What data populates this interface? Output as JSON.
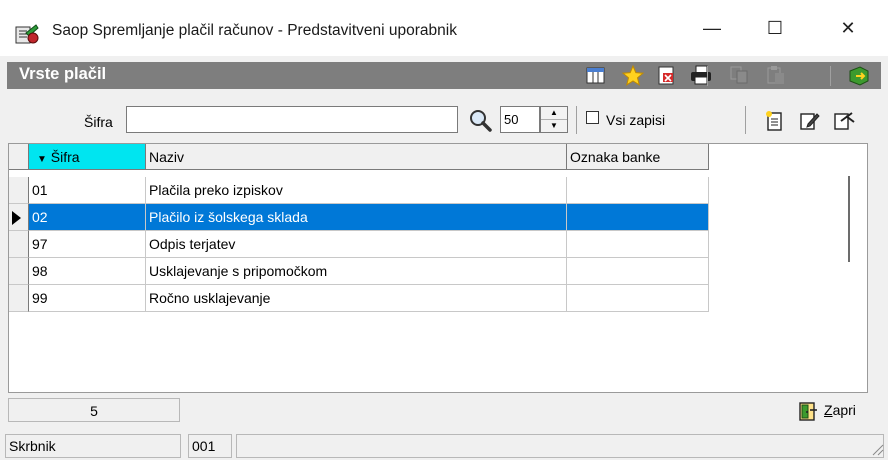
{
  "window": {
    "title": "Saop Spremljanje plačil računov - Predstavitveni uporabnik",
    "minimize_glyph": "—",
    "maximize_glyph": "☐",
    "close_glyph": "✕"
  },
  "header": {
    "title": "Vrste plačil",
    "toolbar_icons": [
      "columns-icon",
      "star-icon",
      "export-icon",
      "print-icon",
      "copy-icon",
      "paste-icon",
      "exit-icon"
    ]
  },
  "search": {
    "label": "Šifra",
    "value": "",
    "count": "50",
    "all_records_label": "Vsi zapisi",
    "all_records_checked": false,
    "action_icons": [
      "new-record-icon",
      "edit-record-icon",
      "delete-record-icon"
    ]
  },
  "grid": {
    "columns": [
      "Šifra",
      "Naziv",
      "Oznaka banke"
    ],
    "sort_column": "Šifra",
    "rows": [
      {
        "sifra": "01",
        "naziv": "Plačila preko izpiskov",
        "oznaka_banke": ""
      },
      {
        "sifra": "02",
        "naziv": "Plačilo iz šolskega sklada",
        "oznaka_banke": ""
      },
      {
        "sifra": "97",
        "naziv": "Odpis terjatev",
        "oznaka_banke": ""
      },
      {
        "sifra": "98",
        "naziv": "Usklajevanje s pripomočkom",
        "oznaka_banke": ""
      },
      {
        "sifra": "99",
        "naziv": "Ročno usklajevanje",
        "oznaka_banke": ""
      }
    ],
    "selected_row": 2
  },
  "footer": {
    "record_count": "5",
    "close_label": "Zapri"
  },
  "status": {
    "user": "Skrbnik",
    "code": "001"
  },
  "colors": {
    "header_bg": "#7e7e7e",
    "sort_column_bg": "#00e5f0",
    "selection_bg": "#0078d7"
  }
}
